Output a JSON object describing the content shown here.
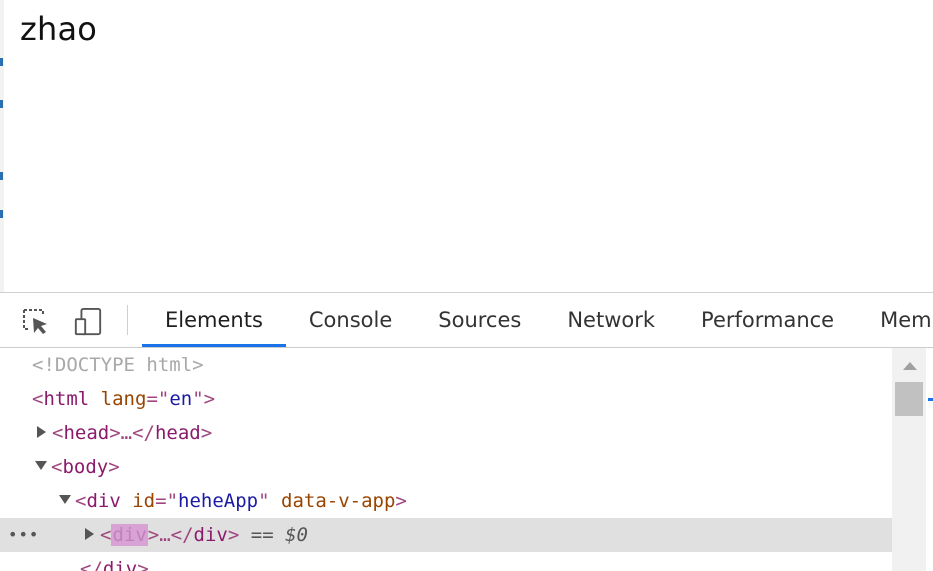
{
  "page": {
    "text": "zhao"
  },
  "devtools": {
    "toolbar": {
      "inspect_icon": "cursor-select-icon",
      "device_icon": "device-toggle-icon"
    },
    "tabs": [
      {
        "label": "Elements",
        "active": true
      },
      {
        "label": "Console",
        "active": false
      },
      {
        "label": "Sources",
        "active": false
      },
      {
        "label": "Network",
        "active": false
      },
      {
        "label": "Performance",
        "active": false
      },
      {
        "label": "Mem",
        "active": false
      }
    ],
    "tree": {
      "doctype": "<!DOCTYPE html>",
      "html": {
        "open": "<",
        "name": "html",
        "attr": "lang",
        "eq": "=\"",
        "value": "en",
        "close": "\">"
      },
      "head": {
        "open": "<",
        "name": "head",
        "mid": ">…</",
        "name2": "head",
        "close": ">"
      },
      "body": {
        "open": "<",
        "name": "body",
        "close": ">"
      },
      "app_div": {
        "open": "<",
        "name": "div",
        "attr1": "id",
        "eq": "=\"",
        "value1": "heheApp",
        "q": "\"",
        "attr2": "data-v-app",
        "close": ">"
      },
      "selected_div": {
        "ellipsis": "•••",
        "open": "<",
        "name": "div",
        "mid": ">…</",
        "name2": "div",
        "close": ">",
        "suffix": "== $0"
      },
      "closing_div": {
        "open": "</",
        "name": "div",
        "close": ">"
      }
    },
    "colors": {
      "accent": "#1a73e8",
      "tag": "#8b1a6b",
      "attr": "#994500",
      "value": "#1a1aa6",
      "selection": "#e0e0e0"
    }
  }
}
